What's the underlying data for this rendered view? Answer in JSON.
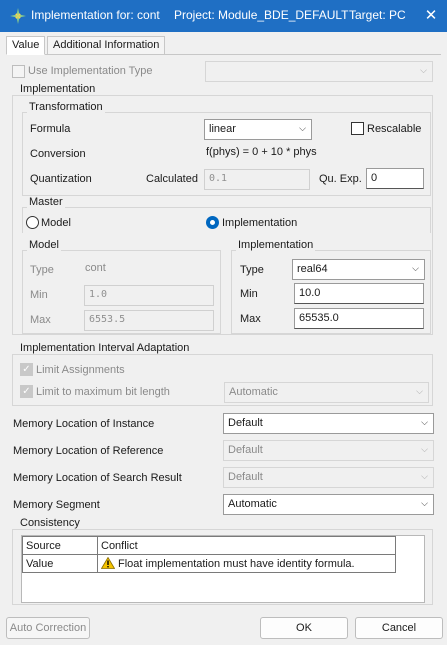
{
  "window": {
    "title": "Implementation for: cont",
    "project": "Project: Module_BDE_DEFAULT",
    "target": "Target: PC",
    "close_glyph": "✕"
  },
  "tabs": [
    {
      "label": "Value",
      "active": true
    },
    {
      "label": "Additional Information",
      "active": false
    }
  ],
  "use_impl_type": {
    "label": "Use Implementation Type",
    "checked": false,
    "enabled": false
  },
  "implementation_group": {
    "title": "Implementation"
  },
  "transformation": {
    "title": "Transformation",
    "formula_label": "Formula",
    "formula_value": "linear",
    "rescalable_label": "Rescalable",
    "rescalable_checked": false,
    "conversion_label": "Conversion",
    "conversion_value": "f(phys) = 0 + 10 * phys",
    "quantization_label": "Quantization",
    "calculated_label": "Calculated",
    "calculated_value": "0.1",
    "qu_exp_label": "Qu. Exp.",
    "qu_exp_value": "0"
  },
  "master": {
    "title": "Master",
    "model_label": "Model",
    "implementation_label": "Implementation",
    "selected": "implementation"
  },
  "model": {
    "title": "Model",
    "type_label": "Type",
    "type_value": "cont",
    "min_label": "Min",
    "min_value": "1.0",
    "max_label": "Max",
    "max_value": "6553.5"
  },
  "implementation": {
    "title": "Implementation",
    "type_label": "Type",
    "type_value": "real64",
    "min_label": "Min",
    "min_value": "10.0",
    "max_label": "Max",
    "max_value": "65535.0"
  },
  "interval": {
    "title": "Implementation Interval Adaptation",
    "limit_assign_label": "Limit Assignments",
    "limit_bits_label": "Limit to maximum bit length",
    "limit_bits_value": "Automatic"
  },
  "memory": {
    "instance_label": "Memory Location of Instance",
    "instance_value": "Default",
    "reference_label": "Memory Location of Reference",
    "reference_value": "Default",
    "search_label": "Memory Location of Search Result",
    "search_value": "Default",
    "segment_label": "Memory Segment",
    "segment_value": "Automatic"
  },
  "consistency": {
    "title": "Consistency",
    "columns": [
      "Source",
      "Conflict"
    ],
    "rows": [
      {
        "source": "Value",
        "conflict": "Float implementation must have identity formula."
      }
    ]
  },
  "buttons": {
    "auto_correction": "Auto Correction",
    "ok": "OK",
    "cancel": "Cancel"
  },
  "colors": {
    "titlebar": "#1f6fc4",
    "accent": "#0067c0",
    "warning": "#f5c400"
  }
}
